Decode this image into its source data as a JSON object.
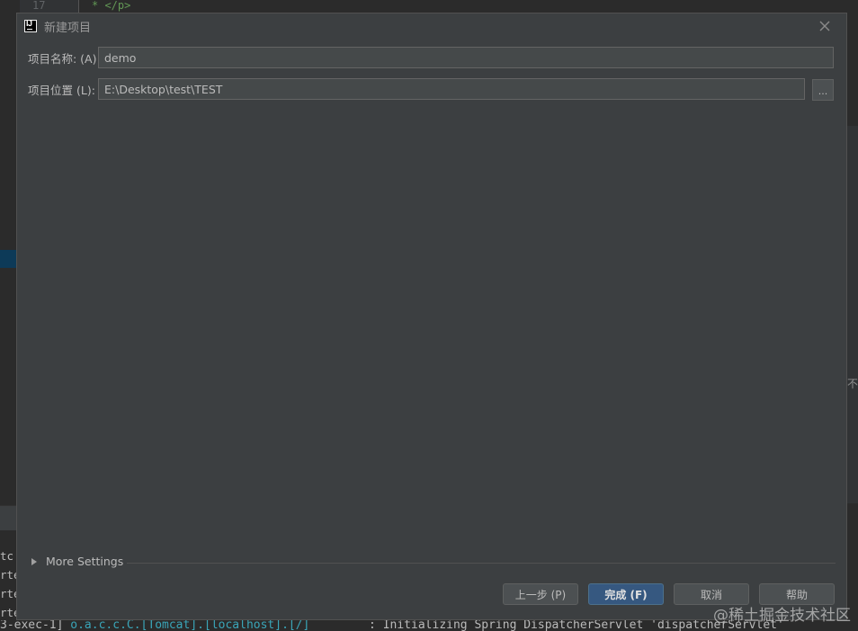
{
  "ide": {
    "line_number": "17",
    "code_line": "* </p>",
    "left_console_lines": [
      "tc",
      "rte",
      "rte",
      "rte",
      "3-e"
    ],
    "right_edge_text": "不",
    "console_bottom": {
      "thread": "3-exec-1]",
      "logger": "o.a.c.c.C.[Tomcat].[localhost].[/]",
      "message": ": Initializing Spring DispatcherServlet 'dispatcherServlet'"
    }
  },
  "dialog": {
    "title": "新建项目",
    "project_name": {
      "label": "项目名称: (A)",
      "value": "demo"
    },
    "project_location": {
      "label": "项目位置 (L):",
      "value": "E:\\Desktop\\test\\TEST",
      "browse_label": "..."
    },
    "more_settings_label": "More Settings",
    "buttons": {
      "previous": "上一步 (P)",
      "finish": "完成 (F)",
      "cancel": "取消",
      "help": "帮助"
    }
  },
  "watermark": "@稀土掘金技术社区",
  "icons": {
    "app": "intellij-idea-icon",
    "close": "close-icon",
    "expand": "triangle-right-icon"
  },
  "colors": {
    "dialog_bg": "#3c3f41",
    "input_bg": "#45494a",
    "primary_button": "#365880",
    "editor_bg": "#2b2b2b"
  }
}
